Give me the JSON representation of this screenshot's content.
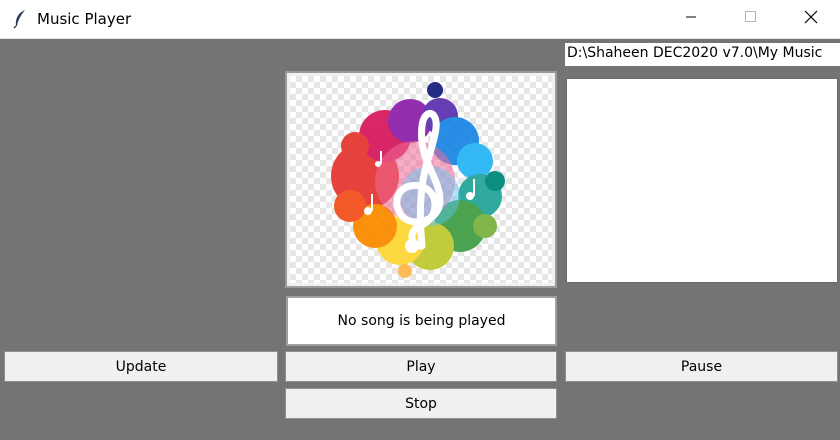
{
  "window": {
    "title": "Music Player",
    "icons": {
      "app": "feather-icon",
      "minimize": "minimize-icon",
      "maximize": "maximize-icon",
      "close": "close-icon"
    }
  },
  "directory": {
    "path": "D:\\Shaheen DEC2020 v7.0\\My Music"
  },
  "playlist": {
    "items": []
  },
  "album_art": {
    "icon": "treble-clef-icon",
    "description_colors": [
      "#e53935",
      "#fb8c00",
      "#fdd835",
      "#43a047",
      "#1e88e5",
      "#8e24aa"
    ]
  },
  "status": {
    "text": "No song is being played"
  },
  "controls": {
    "update_label": "Update",
    "play_label": "Play",
    "pause_label": "Pause",
    "stop_label": "Stop"
  },
  "colors": {
    "background": "#747474",
    "button": "#f0f0f0",
    "titlebar": "#ffffff"
  }
}
